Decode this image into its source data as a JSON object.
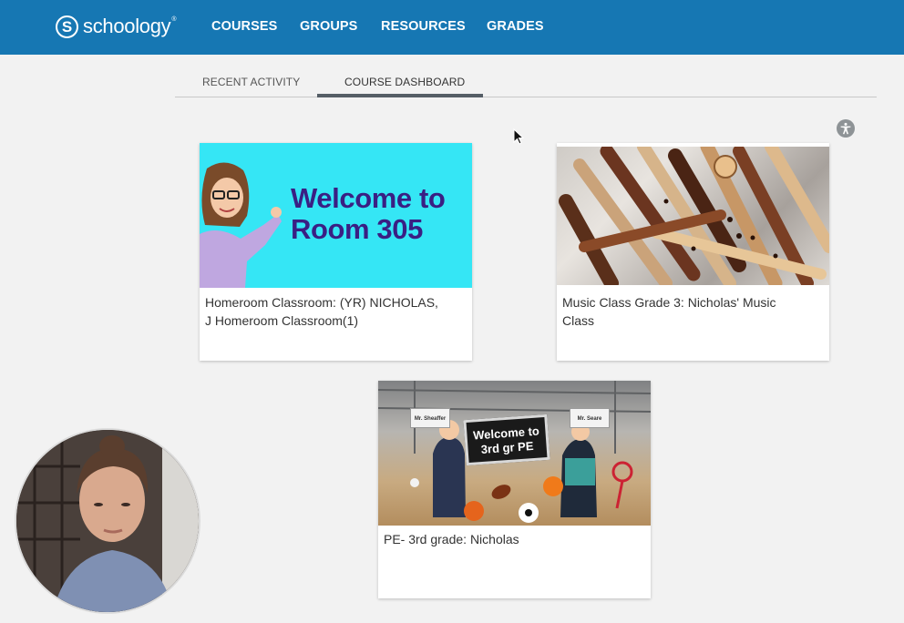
{
  "brand": {
    "name": "schoology",
    "mark": "S",
    "tm": "®"
  },
  "nav": {
    "items": [
      {
        "label": "COURSES"
      },
      {
        "label": "GROUPS"
      },
      {
        "label": "RESOURCES"
      },
      {
        "label": "GRADES"
      }
    ]
  },
  "tabs": [
    {
      "label": "RECENT ACTIVITY",
      "active": false
    },
    {
      "label": "COURSE DASHBOARD",
      "active": true
    }
  ],
  "courses": [
    {
      "title": "Homeroom Classroom: (YR) NICHOLAS, J Homeroom Classroom(1)",
      "image_text_line1": "Welcome to",
      "image_text_line2": "Room 305"
    },
    {
      "title": "Music Class Grade 3: Nicholas' Music Class"
    },
    {
      "title": "PE- 3rd grade: Nicholas",
      "image_sign_line1": "Welcome to",
      "image_sign_line2": "3rd gr PE",
      "bubble_left": "Mr. Sheaffer",
      "bubble_right": "Mr. Seare"
    }
  ],
  "colors": {
    "topbar": "#1677b3",
    "page_bg": "#f2f2f2",
    "welcome_bg": "#35e6f5",
    "welcome_text": "#3a1f83"
  },
  "icons": [
    "accessibility-icon",
    "mouse-cursor-icon"
  ]
}
